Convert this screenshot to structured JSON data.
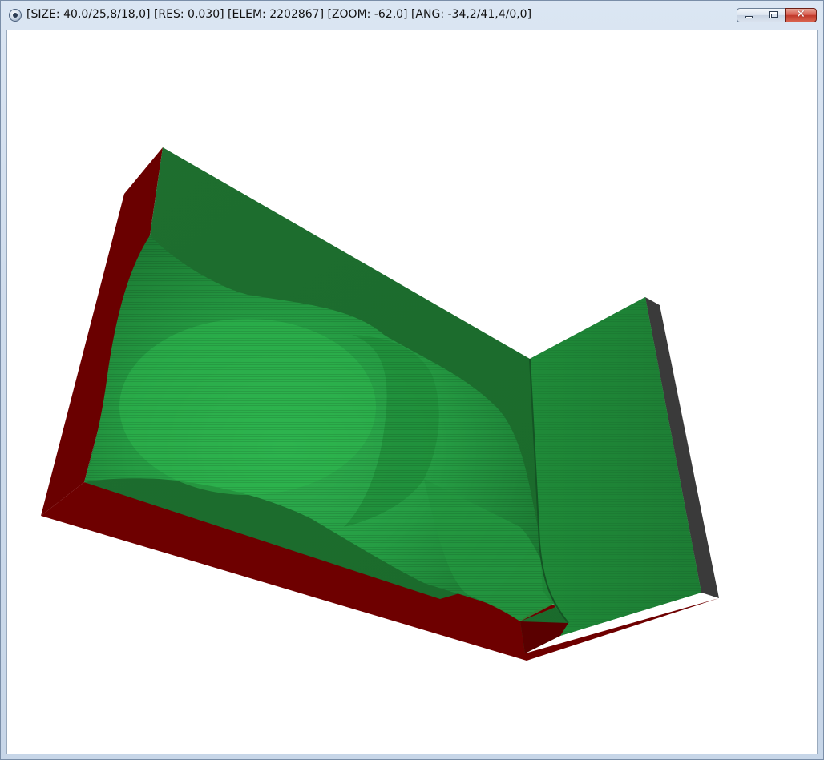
{
  "window": {
    "title": "[SIZE: 40,0/25,8/18,0] [RES: 0,030] [ELEM: 2202867] [ZOOM: -62,0] [ANG: -34,2/41,4/0,0]",
    "buttons": {
      "minimize": "minimize",
      "maximize": "maximize",
      "close": "✕"
    }
  },
  "model": {
    "colors": {
      "top": "#1b6b2d",
      "top_light": "#2aa84a",
      "side_red": "#6e0000",
      "side_red_dark": "#560000",
      "side_gray": "#3c3c3c",
      "background": "#ffffff"
    }
  }
}
